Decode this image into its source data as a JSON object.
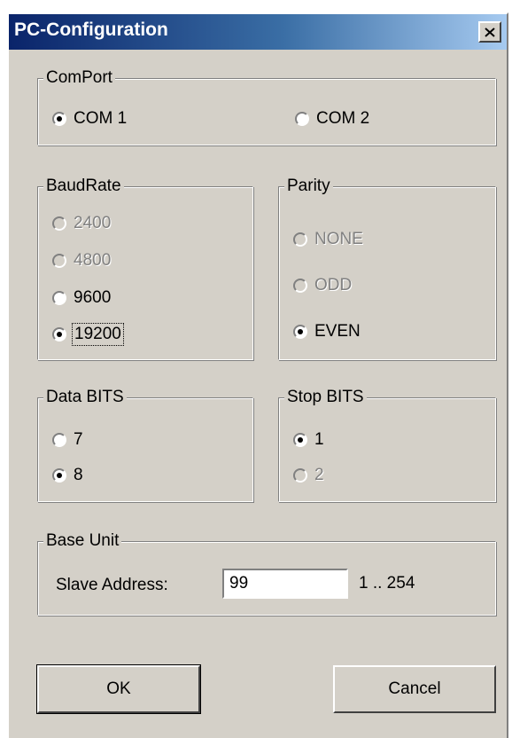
{
  "window": {
    "title": "PC-Configuration"
  },
  "comport": {
    "legend": "ComPort",
    "options": [
      {
        "label": "COM 1",
        "checked": true,
        "disabled": false
      },
      {
        "label": "COM 2",
        "checked": false,
        "disabled": false
      }
    ]
  },
  "baudrate": {
    "legend": "BaudRate",
    "options": [
      {
        "label": "2400",
        "checked": false,
        "disabled": true
      },
      {
        "label": "4800",
        "checked": false,
        "disabled": true
      },
      {
        "label": "9600",
        "checked": false,
        "disabled": false
      },
      {
        "label": "19200",
        "checked": true,
        "disabled": false
      }
    ]
  },
  "parity": {
    "legend": "Parity",
    "options": [
      {
        "label": "NONE",
        "checked": false,
        "disabled": true
      },
      {
        "label": "ODD",
        "checked": false,
        "disabled": true
      },
      {
        "label": "EVEN",
        "checked": true,
        "disabled": false
      }
    ]
  },
  "databits": {
    "legend": "Data BITS",
    "options": [
      {
        "label": "7",
        "checked": false,
        "disabled": false
      },
      {
        "label": "8",
        "checked": true,
        "disabled": false
      }
    ]
  },
  "stopbits": {
    "legend": "Stop BITS",
    "options": [
      {
        "label": "1",
        "checked": true,
        "disabled": false
      },
      {
        "label": "2",
        "checked": false,
        "disabled": true
      }
    ]
  },
  "baseunit": {
    "legend": "Base Unit",
    "slave_label": "Slave Address:",
    "slave_value": "99",
    "range": "1 .. 254"
  },
  "buttons": {
    "ok": "OK",
    "cancel": "Cancel"
  },
  "icons": {
    "close": "close-icon"
  }
}
